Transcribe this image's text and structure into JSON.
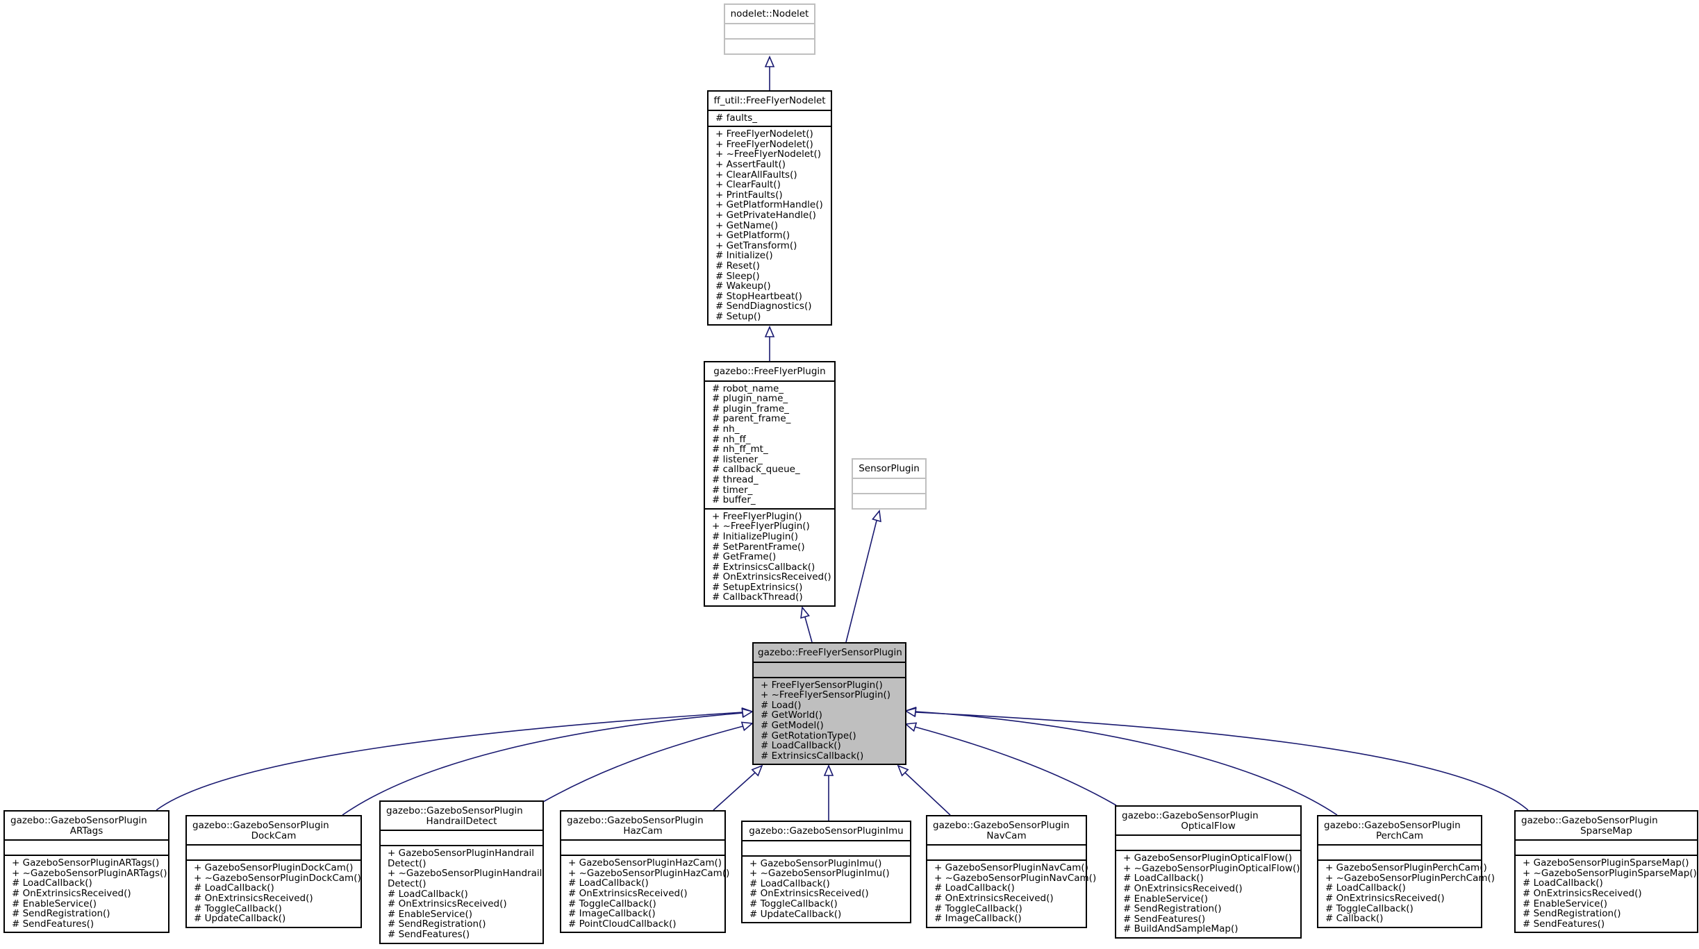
{
  "diagram": {
    "type": "class-inheritance",
    "colors": {
      "edge": "#191970",
      "focus_fill": "#bfbfbf",
      "external_border": "#bfbfbf",
      "border": "#000000"
    },
    "classes": {
      "nodelet": {
        "title": [
          "nodelet::Nodelet"
        ],
        "attributes": [],
        "methods": [],
        "external": true
      },
      "ffnodelet": {
        "title": [
          "ff_util::FreeFlyerNodelet"
        ],
        "attributes": [
          "# faults_"
        ],
        "methods": [
          "+ FreeFlyerNodelet()",
          "+ FreeFlyerNodelet()",
          "+ ~FreeFlyerNodelet()",
          "+ AssertFault()",
          "+ ClearAllFaults()",
          "+ ClearFault()",
          "+ PrintFaults()",
          "+ GetPlatformHandle()",
          "+ GetPrivateHandle()",
          "+ GetName()",
          "+ GetPlatform()",
          "+ GetTransform()",
          "# Initialize()",
          "# Reset()",
          "# Sleep()",
          "# Wakeup()",
          "# StopHeartbeat()",
          "# SendDiagnostics()",
          "# Setup()"
        ]
      },
      "ffplugin": {
        "title": [
          "gazebo::FreeFlyerPlugin"
        ],
        "attributes": [
          "# robot_name_",
          "# plugin_name_",
          "# plugin_frame_",
          "# parent_frame_",
          "# nh_",
          "# nh_ff_",
          "# nh_ff_mt_",
          "# listener_",
          "# callback_queue_",
          "# thread_",
          "# timer_",
          "# buffer_"
        ],
        "methods": [
          "+ FreeFlyerPlugin()",
          "+ ~FreeFlyerPlugin()",
          "# InitializePlugin()",
          "# SetParentFrame()",
          "# GetFrame()",
          "# ExtrinsicsCallback()",
          "# OnExtrinsicsReceived()",
          "# SetupExtrinsics()",
          "# CallbackThread()"
        ]
      },
      "sensorplugin": {
        "title": [
          "SensorPlugin"
        ],
        "attributes": [],
        "methods": [],
        "external": true
      },
      "ffsensor": {
        "title": [
          "gazebo::FreeFlyerSensorPlugin"
        ],
        "attributes": [],
        "methods": [
          "+ FreeFlyerSensorPlugin()",
          "+ ~FreeFlyerSensorPlugin()",
          "# Load()",
          "# GetWorld()",
          "# GetModel()",
          "# GetRotationType()",
          "# LoadCallback()",
          "# ExtrinsicsCallback()"
        ],
        "focus": true
      },
      "artags": {
        "title": [
          "gazebo::GazeboSensorPlugin",
          "ARTags"
        ],
        "attributes": [],
        "methods": [
          "+ GazeboSensorPluginARTags()",
          "+ ~GazeboSensorPluginARTags()",
          "# LoadCallback()",
          "# OnExtrinsicsReceived()",
          "# EnableService()",
          "# SendRegistration()",
          "# SendFeatures()"
        ]
      },
      "dockcam": {
        "title": [
          "gazebo::GazeboSensorPlugin",
          "DockCam"
        ],
        "attributes": [],
        "methods": [
          "+ GazeboSensorPluginDockCam()",
          "+ ~GazeboSensorPluginDockCam()",
          "# LoadCallback()",
          "# OnExtrinsicsReceived()",
          "# ToggleCallback()",
          "# UpdateCallback()"
        ]
      },
      "handrail": {
        "title": [
          "gazebo::GazeboSensorPlugin",
          "HandrailDetect"
        ],
        "attributes": [],
        "methods": [
          "+ GazeboSensorPluginHandrail",
          "Detect()",
          "+ ~GazeboSensorPluginHandrail",
          "Detect()",
          "# LoadCallback()",
          "# OnExtrinsicsReceived()",
          "# EnableService()",
          "# SendRegistration()",
          "# SendFeatures()"
        ]
      },
      "hazcam": {
        "title": [
          "gazebo::GazeboSensorPlugin",
          "HazCam"
        ],
        "attributes": [],
        "methods": [
          "+ GazeboSensorPluginHazCam()",
          "+ ~GazeboSensorPluginHazCam()",
          "# LoadCallback()",
          "# OnExtrinsicsReceived()",
          "# ToggleCallback()",
          "# ImageCallback()",
          "# PointCloudCallback()"
        ]
      },
      "imu": {
        "title": [
          "gazebo::GazeboSensorPluginImu"
        ],
        "attributes": [],
        "methods": [
          "+ GazeboSensorPluginImu()",
          "+ ~GazeboSensorPluginImu()",
          "# LoadCallback()",
          "# OnExtrinsicsReceived()",
          "# ToggleCallback()",
          "# UpdateCallback()"
        ]
      },
      "navcam": {
        "title": [
          "gazebo::GazeboSensorPlugin",
          "NavCam"
        ],
        "attributes": [],
        "methods": [
          "+ GazeboSensorPluginNavCam()",
          "+ ~GazeboSensorPluginNavCam()",
          "# LoadCallback()",
          "# OnExtrinsicsReceived()",
          "# ToggleCallback()",
          "# ImageCallback()"
        ]
      },
      "opticalflow": {
        "title": [
          "gazebo::GazeboSensorPlugin",
          "OpticalFlow"
        ],
        "attributes": [],
        "methods": [
          "+ GazeboSensorPluginOpticalFlow()",
          "+ ~GazeboSensorPluginOpticalFlow()",
          "# LoadCallback()",
          "# OnExtrinsicsReceived()",
          "# EnableService()",
          "# SendRegistration()",
          "# SendFeatures()",
          "# BuildAndSampleMap()"
        ]
      },
      "perchcam": {
        "title": [
          "gazebo::GazeboSensorPlugin",
          "PerchCam"
        ],
        "attributes": [],
        "methods": [
          "+ GazeboSensorPluginPerchCam()",
          "+ ~GazeboSensorPluginPerchCam()",
          "# LoadCallback()",
          "# OnExtrinsicsReceived()",
          "# ToggleCallback()",
          "# Callback()"
        ]
      },
      "sparsemap": {
        "title": [
          "gazebo::GazeboSensorPlugin",
          "SparseMap"
        ],
        "attributes": [],
        "methods": [
          "+ GazeboSensorPluginSparseMap()",
          "+ ~GazeboSensorPluginSparseMap()",
          "# LoadCallback()",
          "# OnExtrinsicsReceived()",
          "# EnableService()",
          "# SendRegistration()",
          "# SendFeatures()"
        ]
      }
    },
    "inheritance": [
      {
        "child": "ffnodelet",
        "parent": "nodelet"
      },
      {
        "child": "ffplugin",
        "parent": "ffnodelet"
      },
      {
        "child": "ffsensor",
        "parent": "ffplugin"
      },
      {
        "child": "ffsensor",
        "parent": "sensorplugin"
      },
      {
        "child": "artags",
        "parent": "ffsensor"
      },
      {
        "child": "dockcam",
        "parent": "ffsensor"
      },
      {
        "child": "handrail",
        "parent": "ffsensor"
      },
      {
        "child": "hazcam",
        "parent": "ffsensor"
      },
      {
        "child": "imu",
        "parent": "ffsensor"
      },
      {
        "child": "navcam",
        "parent": "ffsensor"
      },
      {
        "child": "opticalflow",
        "parent": "ffsensor"
      },
      {
        "child": "perchcam",
        "parent": "ffsensor"
      },
      {
        "child": "sparsemap",
        "parent": "ffsensor"
      }
    ]
  }
}
